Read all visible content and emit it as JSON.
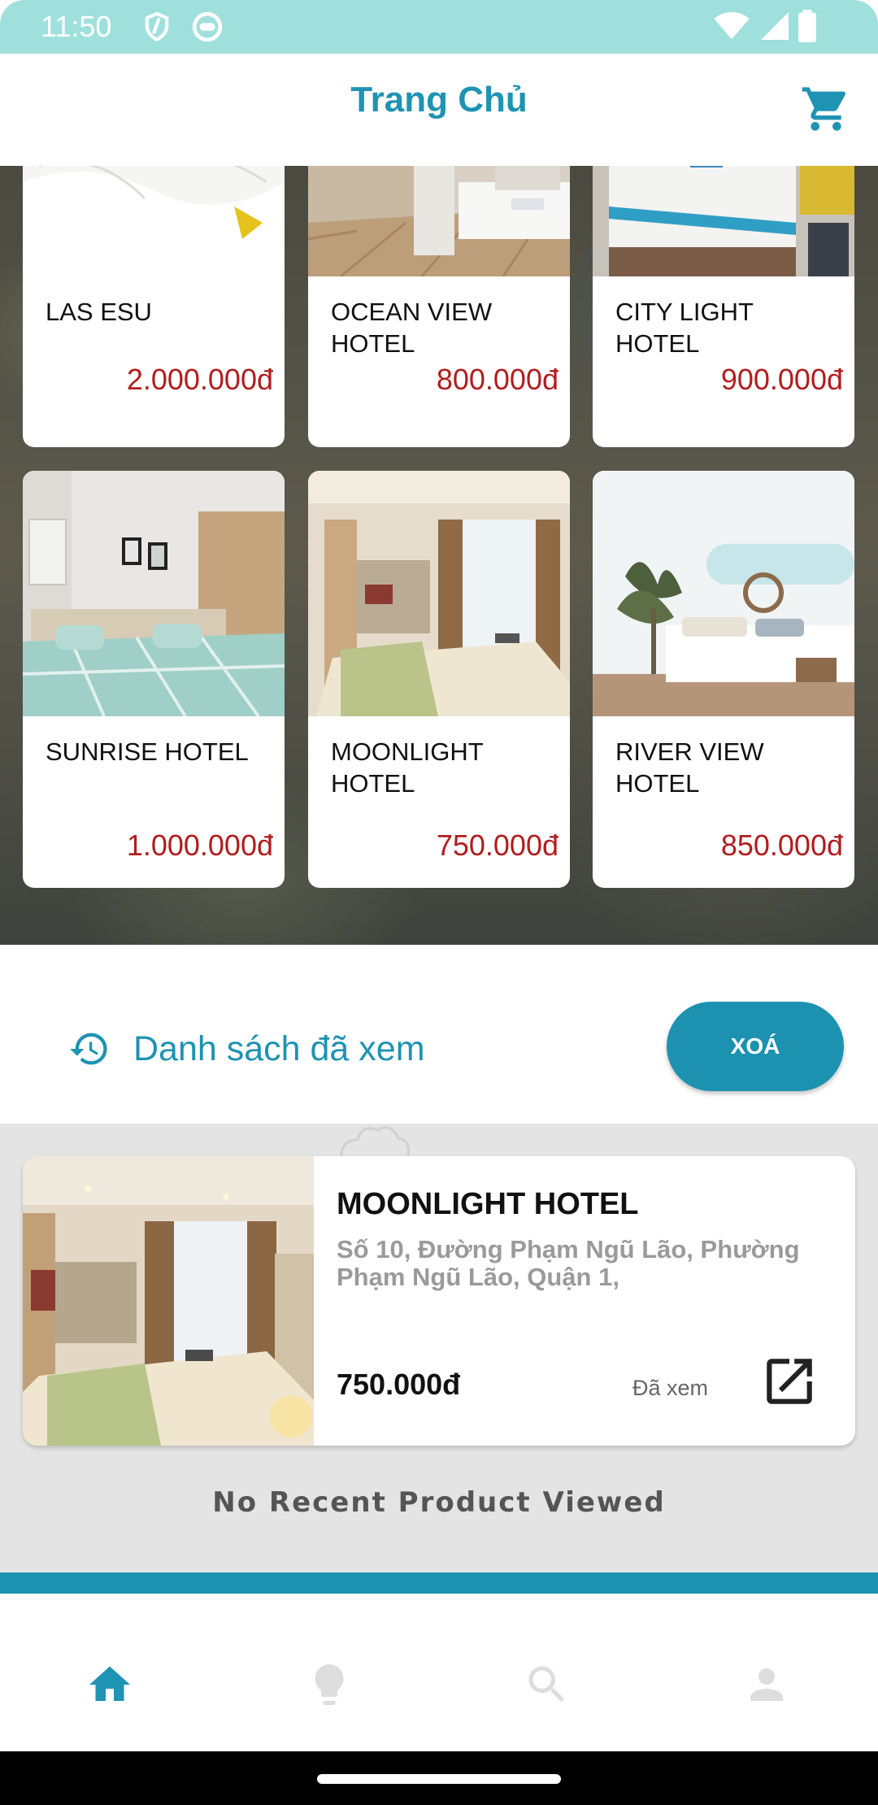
{
  "status_bar": {
    "time": "11:50"
  },
  "app_bar": {
    "title": "Trang Chủ"
  },
  "hotels": [
    {
      "name": "LAS ESU",
      "price": "2.000.000đ"
    },
    {
      "name": "OCEAN VIEW HOTEL",
      "price": "800.000đ"
    },
    {
      "name": "CITY LIGHT HOTEL",
      "price": "900.000đ"
    },
    {
      "name": "SUNRISE HOTEL",
      "price": "1.000.000đ"
    },
    {
      "name": "MOONLIGHT HOTEL",
      "price": "750.000đ"
    },
    {
      "name": "RIVER VIEW HOTEL",
      "price": "850.000đ"
    }
  ],
  "recent": {
    "title": "Danh sách đã xem",
    "clear_label": "XOÁ",
    "item": {
      "name": "MOONLIGHT HOTEL",
      "address": "Số 10, Đường Phạm Ngũ Lão, Phường Phạm Ngũ Lão, Quận 1,",
      "price": "750.000đ",
      "status": "Đã xem"
    },
    "empty_text": "No Recent Product Viewed"
  },
  "bottom_nav": {
    "items": [
      {
        "icon": "home-icon",
        "active": true
      },
      {
        "icon": "lightbulb-icon",
        "active": false
      },
      {
        "icon": "search-icon",
        "active": false
      },
      {
        "icon": "person-icon",
        "active": false
      }
    ]
  },
  "colors": {
    "accent": "#1f93b3",
    "price": "#b11e1e",
    "status_bar": "#9fe0dc",
    "nav_inactive": "#dddddd"
  }
}
